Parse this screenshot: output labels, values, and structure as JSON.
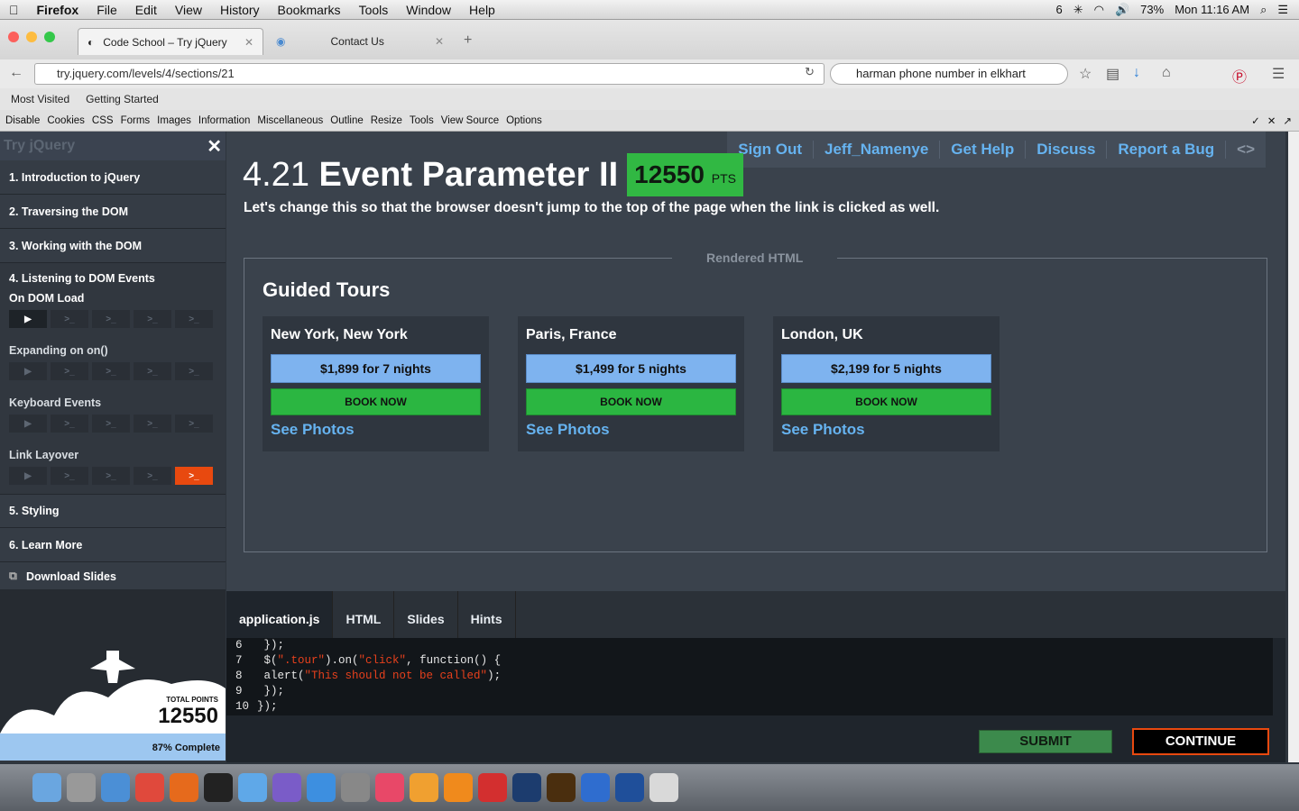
{
  "menubar": {
    "app": "Firefox",
    "items": [
      "File",
      "Edit",
      "View",
      "History",
      "Bookmarks",
      "Tools",
      "Window",
      "Help"
    ],
    "status": {
      "battery": "73%",
      "clock": "Mon 11:16 AM",
      "badge": "6"
    }
  },
  "tabs": [
    {
      "label": "Code School – Try jQuery"
    },
    {
      "label": "Contact Us"
    }
  ],
  "nav": {
    "url": "try.jquery.com/levels/4/sections/21",
    "search": "harman phone number in elkhart"
  },
  "bookmarks": [
    "Most Visited",
    "Getting Started"
  ],
  "devbar": [
    "Disable",
    "Cookies",
    "CSS",
    "Forms",
    "Images",
    "Information",
    "Miscellaneous",
    "Outline",
    "Resize",
    "Tools",
    "View Source",
    "Options"
  ],
  "sidebar": {
    "title": "Try jQuery",
    "levels": [
      "1. Introduction to jQuery",
      "2. Traversing the DOM",
      "3. Working with the DOM",
      "4. Listening to DOM Events",
      "5. Styling",
      "6. Learn More"
    ],
    "sections": [
      "On DOM Load",
      "Expanding on on()",
      "Keyboard Events",
      "Link Layover"
    ],
    "download": "Download Slides",
    "total_label": "TOTAL POINTS",
    "total": "12550",
    "progress": "87% Complete",
    "progress_value": 87
  },
  "main": {
    "topnav": [
      "Sign Out",
      "Jeff_Namenye",
      "Get Help",
      "Discuss",
      "Report a Bug"
    ],
    "title_num": "4.21",
    "title": "Event Parameter II",
    "points": "12550",
    "pts": "PTS",
    "desc": "Let's change this so that the browser doesn't jump to the top of the page when the link is clicked as well.",
    "rendered": "Rendered HTML",
    "tours_heading": "Guided Tours",
    "tours": [
      {
        "city": "New York, New York",
        "price": "$1,899 for 7 nights",
        "book": "BOOK NOW",
        "photos": "See Photos"
      },
      {
        "city": "Paris, France",
        "price": "$1,499 for 5 nights",
        "book": "BOOK NOW",
        "photos": "See Photos"
      },
      {
        "city": "London, UK",
        "price": "$2,199 for 5 nights",
        "book": "BOOK NOW",
        "photos": "See Photos"
      }
    ]
  },
  "editor": {
    "tabs": [
      "application.js",
      "HTML",
      "Slides",
      "Hints"
    ],
    "submit": "SUBMIT",
    "continue": "CONTINUE"
  }
}
